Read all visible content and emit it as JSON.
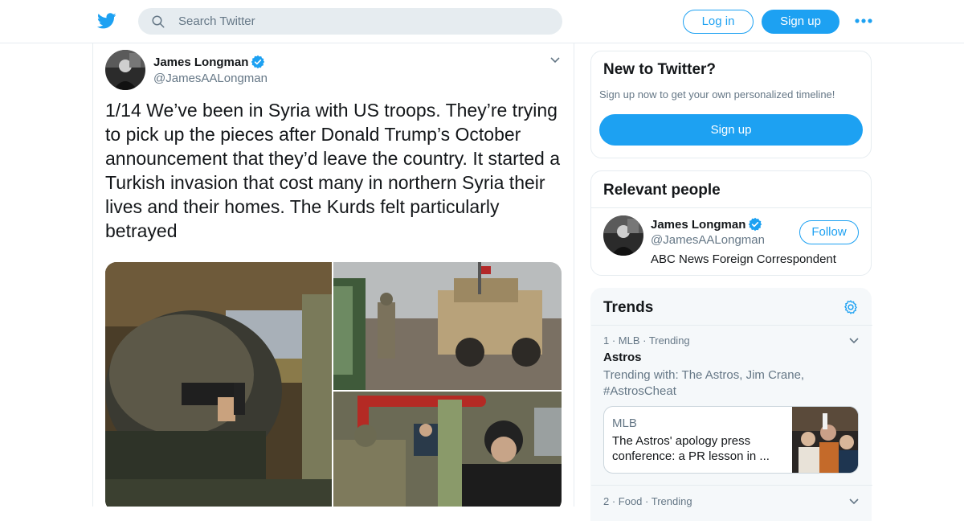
{
  "header": {
    "logo": "twitter-bird-icon",
    "search_placeholder": "Search Twitter",
    "login_label": "Log in",
    "signup_label": "Sign up",
    "more_icon": "more-dots-icon"
  },
  "tweet": {
    "author_name": "James Longman",
    "author_handle": "@JamesAALongman",
    "verified": true,
    "text": "1/14 We’ve been in Syria with US troops. They’re trying to pick up the pieces after Donald Trump’s October announcement that they’d leave the country. It started a Turkish invasion that cost many in northern Syria their lives and their homes. The Kurds felt particularly betrayed",
    "media_count": 3
  },
  "new_to_twitter": {
    "title": "New to Twitter?",
    "subtitle": "Sign up now to get your own personalized timeline!",
    "signup_label": "Sign up"
  },
  "relevant_people": {
    "title": "Relevant people",
    "people": [
      {
        "name": "James Longman",
        "handle": "@JamesAALongman",
        "bio": "ABC News Foreign Correspondent",
        "follow_label": "Follow"
      }
    ]
  },
  "trends": {
    "title": "Trends",
    "items": [
      {
        "meta": "1 · MLB · Trending",
        "title": "Astros",
        "with": "Trending with: The Astros, Jim Crane, #AstrosCheat",
        "card": {
          "source": "MLB",
          "headline": "The Astros' apology press conference: a PR lesson in ..."
        }
      },
      {
        "meta": "2 · Food · Trending"
      }
    ]
  },
  "colors": {
    "brand": "#1da1f2",
    "text": "#14171a",
    "secondary": "#657786",
    "border": "#e6ecf0"
  }
}
